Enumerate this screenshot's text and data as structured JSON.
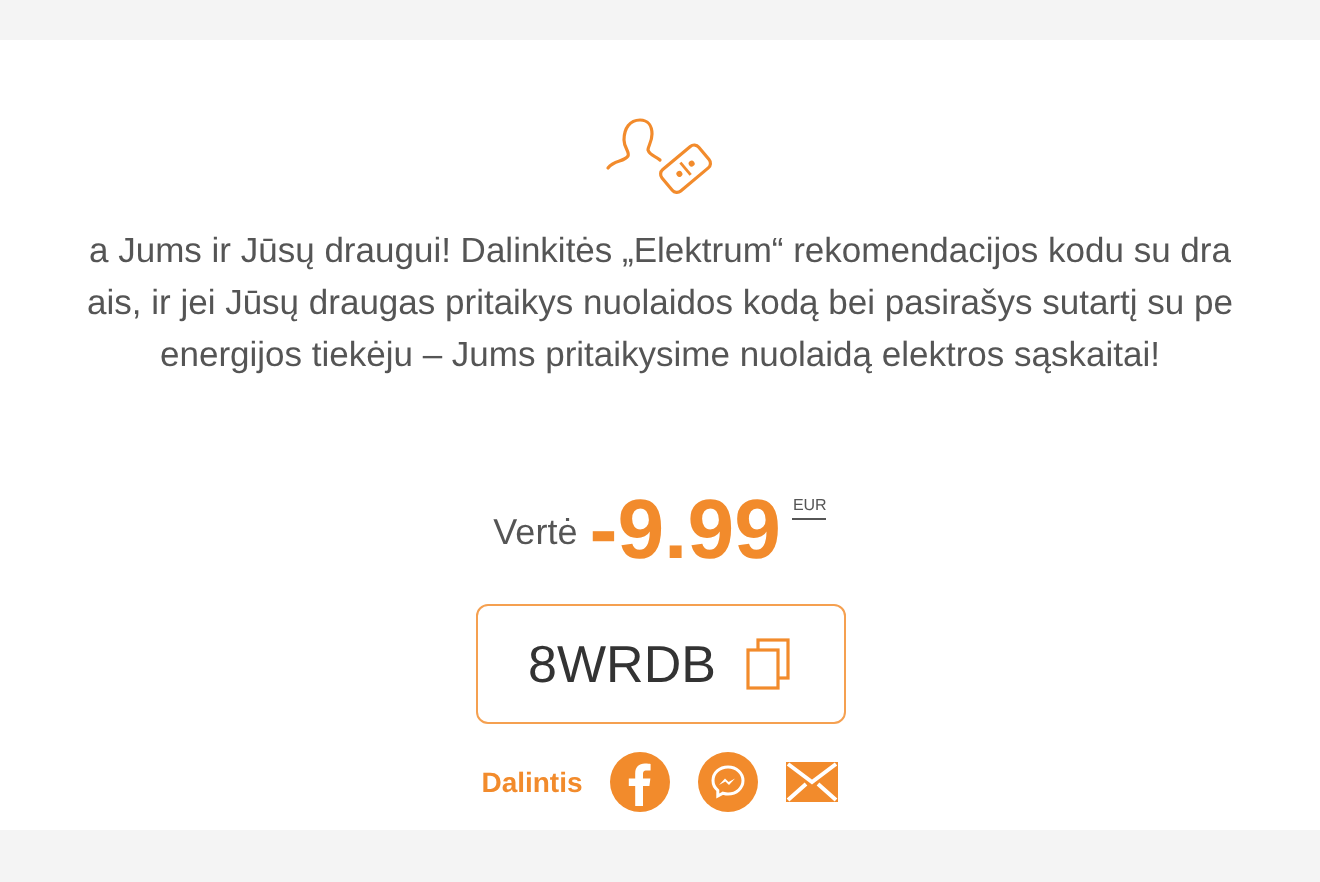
{
  "description_lines": [
    "a Jums ir Jūsų draugui! Dalinkitės „Elektrum“ rekomendacijos kodu su dra",
    "ais, ir jei Jūsų draugas pritaikys nuolaidos kodą bei pasirašys sutartį su pe",
    "energijos tiekėju – Jums pritaikysime nuolaidą elektros sąskaitai!"
  ],
  "value": {
    "label": "Vertė",
    "amount": "-9.99",
    "currency": "EUR"
  },
  "code": {
    "text": "8WRDB"
  },
  "share": {
    "label": "Dalintis",
    "channels": [
      {
        "kind": "facebook"
      },
      {
        "kind": "messenger"
      },
      {
        "kind": "email"
      }
    ]
  }
}
